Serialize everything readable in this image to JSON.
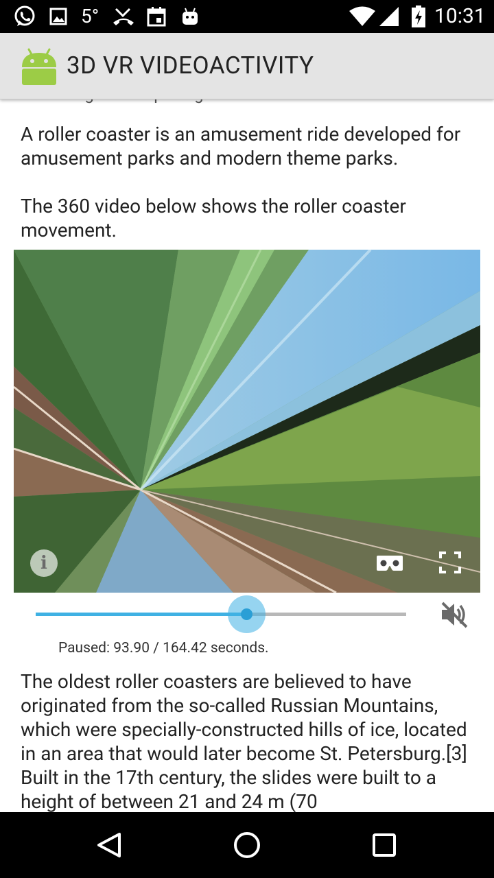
{
  "status_bar": {
    "temperature": "5°",
    "time": "10:31",
    "icons": [
      "whatsapp-icon",
      "image-icon",
      "missed-call-icon",
      "calendar-icon",
      "android-robot-icon",
      "wifi-icon",
      "cell-signal-icon",
      "battery-charging-icon"
    ]
  },
  "app_bar": {
    "title": "3D VR VIDEOACTIVITY",
    "logo": "android-logo"
  },
  "content": {
    "subtitle_clipped": "A Thrilling and Surprising ride",
    "paragraph_1": "A roller coaster is an amusement ride developed for amusement parks and modern theme parks.",
    "paragraph_2": "The 360 video below shows the roller coaster movement.",
    "video": {
      "info_icon": "info-icon",
      "cardboard_icon": "vr-cardboard-icon",
      "fullscreen_icon": "fullscreen-icon"
    },
    "seekbar": {
      "progress_fraction": 0.571,
      "color": "#3fb1e3",
      "track_color": "#b8b8b8"
    },
    "mute_icon": "volume-off-icon",
    "playback_status": "Paused: 93.90 / 164.42 seconds.",
    "paragraph_3": "The oldest roller coasters are believed to have originated from the so-called Russian Mountains, which were specially-constructed hills of ice, located in an area that would later become St. Petersburg.[3] Built in the 17th century, the slides were built to a height of between 21 and 24 m (70"
  },
  "nav_bar": {
    "back_icon": "back-icon",
    "home_icon": "home-icon",
    "recents_icon": "recents-icon"
  }
}
